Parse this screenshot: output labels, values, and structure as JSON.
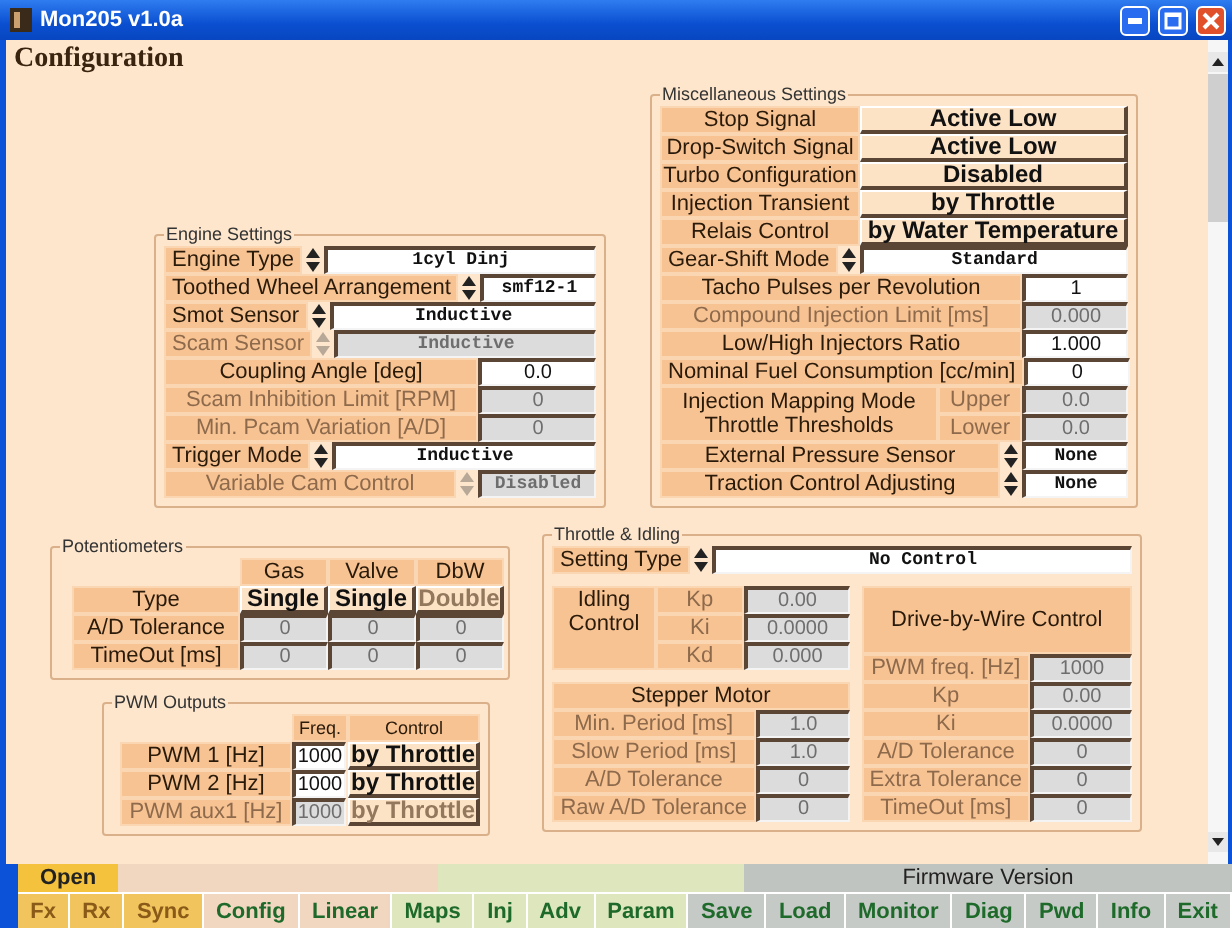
{
  "window": {
    "title": "Mon205 v1.0a"
  },
  "page_title": "Configuration",
  "engine_settings": {
    "title": "Engine Settings",
    "rows": [
      {
        "kind": "select",
        "label": "Engine Type",
        "value": "1cyl Dinj",
        "disabled": false
      },
      {
        "kind": "select",
        "label": "Toothed Wheel Arrangement",
        "value": "smf12-1",
        "disabled": false
      },
      {
        "kind": "select",
        "label": "Smot Sensor",
        "value": "Inductive",
        "disabled": false
      },
      {
        "kind": "select",
        "label": "Scam Sensor",
        "value": "Inductive",
        "disabled": true
      },
      {
        "kind": "number",
        "label": "Coupling Angle [deg]",
        "value": "0.0",
        "disabled": false
      },
      {
        "kind": "number",
        "label": "Scam Inhibition Limit [RPM]",
        "value": "0",
        "disabled": true
      },
      {
        "kind": "number",
        "label": "Min. Pcam Variation [A/D]",
        "value": "0",
        "disabled": true
      },
      {
        "kind": "select",
        "label": "Trigger Mode",
        "value": "Inductive",
        "disabled": false
      },
      {
        "kind": "select-wide",
        "label": "Variable Cam Control",
        "value": "Disabled",
        "disabled": true
      }
    ]
  },
  "misc_settings": {
    "title": "Miscellaneous Settings",
    "rows": [
      {
        "kind": "toggle",
        "label": "Stop Signal",
        "value": "Active Low",
        "disabled": false
      },
      {
        "kind": "toggle",
        "label": "Drop-Switch Signal",
        "value": "Active Low",
        "disabled": false
      },
      {
        "kind": "toggle",
        "label": "Turbo Configuration",
        "value": "Disabled",
        "disabled": false
      },
      {
        "kind": "toggle",
        "label": "Injection Transient",
        "value": "by Throttle",
        "disabled": false
      },
      {
        "kind": "toggle",
        "label": "Relais Control",
        "value": "by Water Temperature",
        "disabled": false
      },
      {
        "kind": "select",
        "label": "Gear-Shift Mode",
        "value": "Standard",
        "disabled": false
      },
      {
        "kind": "number",
        "label": "Tacho Pulses per Revolution",
        "value": "1",
        "disabled": false
      },
      {
        "kind": "number",
        "label": "Compound Injection Limit [ms]",
        "value": "0.000",
        "disabled": true
      },
      {
        "kind": "number",
        "label": "Low/High Injectors Ratio",
        "value": "1.000",
        "disabled": false
      },
      {
        "kind": "number",
        "label": "Nominal Fuel Consumption [cc/min]",
        "value": "0",
        "disabled": false
      },
      {
        "kind": "pair",
        "label": "Injection Mapping Mode Throttle Thresholds",
        "fields": [
          {
            "label": "Upper",
            "value": "0.0",
            "disabled": true
          },
          {
            "label": "Lower",
            "value": "0.0",
            "disabled": true
          }
        ]
      },
      {
        "kind": "select-wide",
        "label": "External Pressure Sensor",
        "value": "None",
        "disabled": false
      },
      {
        "kind": "select-wide",
        "label": "Traction Control Adjusting",
        "value": "None",
        "disabled": false
      }
    ]
  },
  "potentiometers": {
    "title": "Potentiometers",
    "columns": [
      "Gas",
      "Valve",
      "DbW"
    ],
    "rows": [
      {
        "kind": "toggle",
        "label": "Type",
        "values": [
          {
            "value": "Single",
            "disabled": false
          },
          {
            "value": "Single",
            "disabled": false
          },
          {
            "value": "Double",
            "disabled": true
          }
        ]
      },
      {
        "kind": "number",
        "label": "A/D Tolerance",
        "values": [
          {
            "value": "0",
            "disabled": true
          },
          {
            "value": "0",
            "disabled": true
          },
          {
            "value": "0",
            "disabled": true
          }
        ]
      },
      {
        "kind": "number",
        "label": "TimeOut [ms]",
        "values": [
          {
            "value": "0",
            "disabled": true
          },
          {
            "value": "0",
            "disabled": true
          },
          {
            "value": "0",
            "disabled": true
          }
        ]
      }
    ]
  },
  "pwm_outputs": {
    "title": "PWM Outputs",
    "columns": [
      "Freq.",
      "Control"
    ],
    "rows": [
      {
        "label": "PWM 1  [Hz]",
        "freq": "1000",
        "control": "by Throttle",
        "disabled": false
      },
      {
        "label": "PWM 2  [Hz]",
        "freq": "1000",
        "control": "by Throttle",
        "disabled": false
      },
      {
        "label": "PWM aux1  [Hz]",
        "freq": "1000",
        "control": "by Throttle",
        "disabled": true
      }
    ]
  },
  "throttle_idling": {
    "title": "Throttle & Idling",
    "setting_type": {
      "label": "Setting Type",
      "value": "No Control"
    },
    "idling": {
      "title": "Idling Control",
      "params": [
        {
          "label": "Kp",
          "value": "0.00",
          "disabled": true
        },
        {
          "label": "Ki",
          "value": "0.0000",
          "disabled": true
        },
        {
          "label": "Kd",
          "value": "0.000",
          "disabled": true
        }
      ]
    },
    "stepper": {
      "title": "Stepper Motor",
      "rows": [
        {
          "label": "Min. Period [ms]",
          "value": "1.0",
          "disabled": true
        },
        {
          "label": "Slow Period [ms]",
          "value": "1.0",
          "disabled": true
        },
        {
          "label": "A/D Tolerance",
          "value": "0",
          "disabled": true
        },
        {
          "label": "Raw A/D Tolerance",
          "value": "0",
          "disabled": true
        }
      ]
    },
    "dbw": {
      "title": "Drive-by-Wire Control",
      "rows": [
        {
          "label": "PWM freq.  [Hz]",
          "value": "1000",
          "disabled": true
        },
        {
          "label": "Kp",
          "value": "0.00",
          "disabled": true
        },
        {
          "label": "Ki",
          "value": "0.0000",
          "disabled": true
        },
        {
          "label": "A/D Tolerance",
          "value": "0",
          "disabled": true
        },
        {
          "label": "Extra Tolerance",
          "value": "0",
          "disabled": true
        },
        {
          "label": "TimeOut [ms]",
          "value": "0",
          "disabled": true
        }
      ]
    }
  },
  "status_bar": {
    "connection": "Open",
    "firmware": "Firmware Version"
  },
  "buttons": [
    {
      "label": "Fx",
      "color": "#f2c45e",
      "disabled": true
    },
    {
      "label": "Rx",
      "color": "#f2c45e",
      "disabled": true
    },
    {
      "label": "Sync",
      "color": "#f2c45e",
      "disabled": true
    },
    {
      "label": "Config",
      "color": "#f1d6c0",
      "disabled": false
    },
    {
      "label": "Linear",
      "color": "#f1d6c0",
      "disabled": false
    },
    {
      "label": "Maps",
      "color": "#dde6bd",
      "disabled": false
    },
    {
      "label": "Inj",
      "color": "#dde6bd",
      "disabled": false
    },
    {
      "label": "Adv",
      "color": "#dde6bd",
      "disabled": false
    },
    {
      "label": "Param",
      "color": "#dde6bd",
      "disabled": false
    },
    {
      "label": "Save",
      "color": "#c6cac6",
      "disabled": false
    },
    {
      "label": "Load",
      "color": "#c6cac6",
      "disabled": false
    },
    {
      "label": "Monitor",
      "color": "#c6cac6",
      "disabled": false
    },
    {
      "label": "Diag",
      "color": "#c6cac6",
      "disabled": false
    },
    {
      "label": "Pwd",
      "color": "#c6cac6",
      "disabled": false
    },
    {
      "label": "Info",
      "color": "#c6cac6",
      "disabled": false
    },
    {
      "label": "Exit",
      "color": "#c6cac6",
      "disabled": false
    }
  ]
}
